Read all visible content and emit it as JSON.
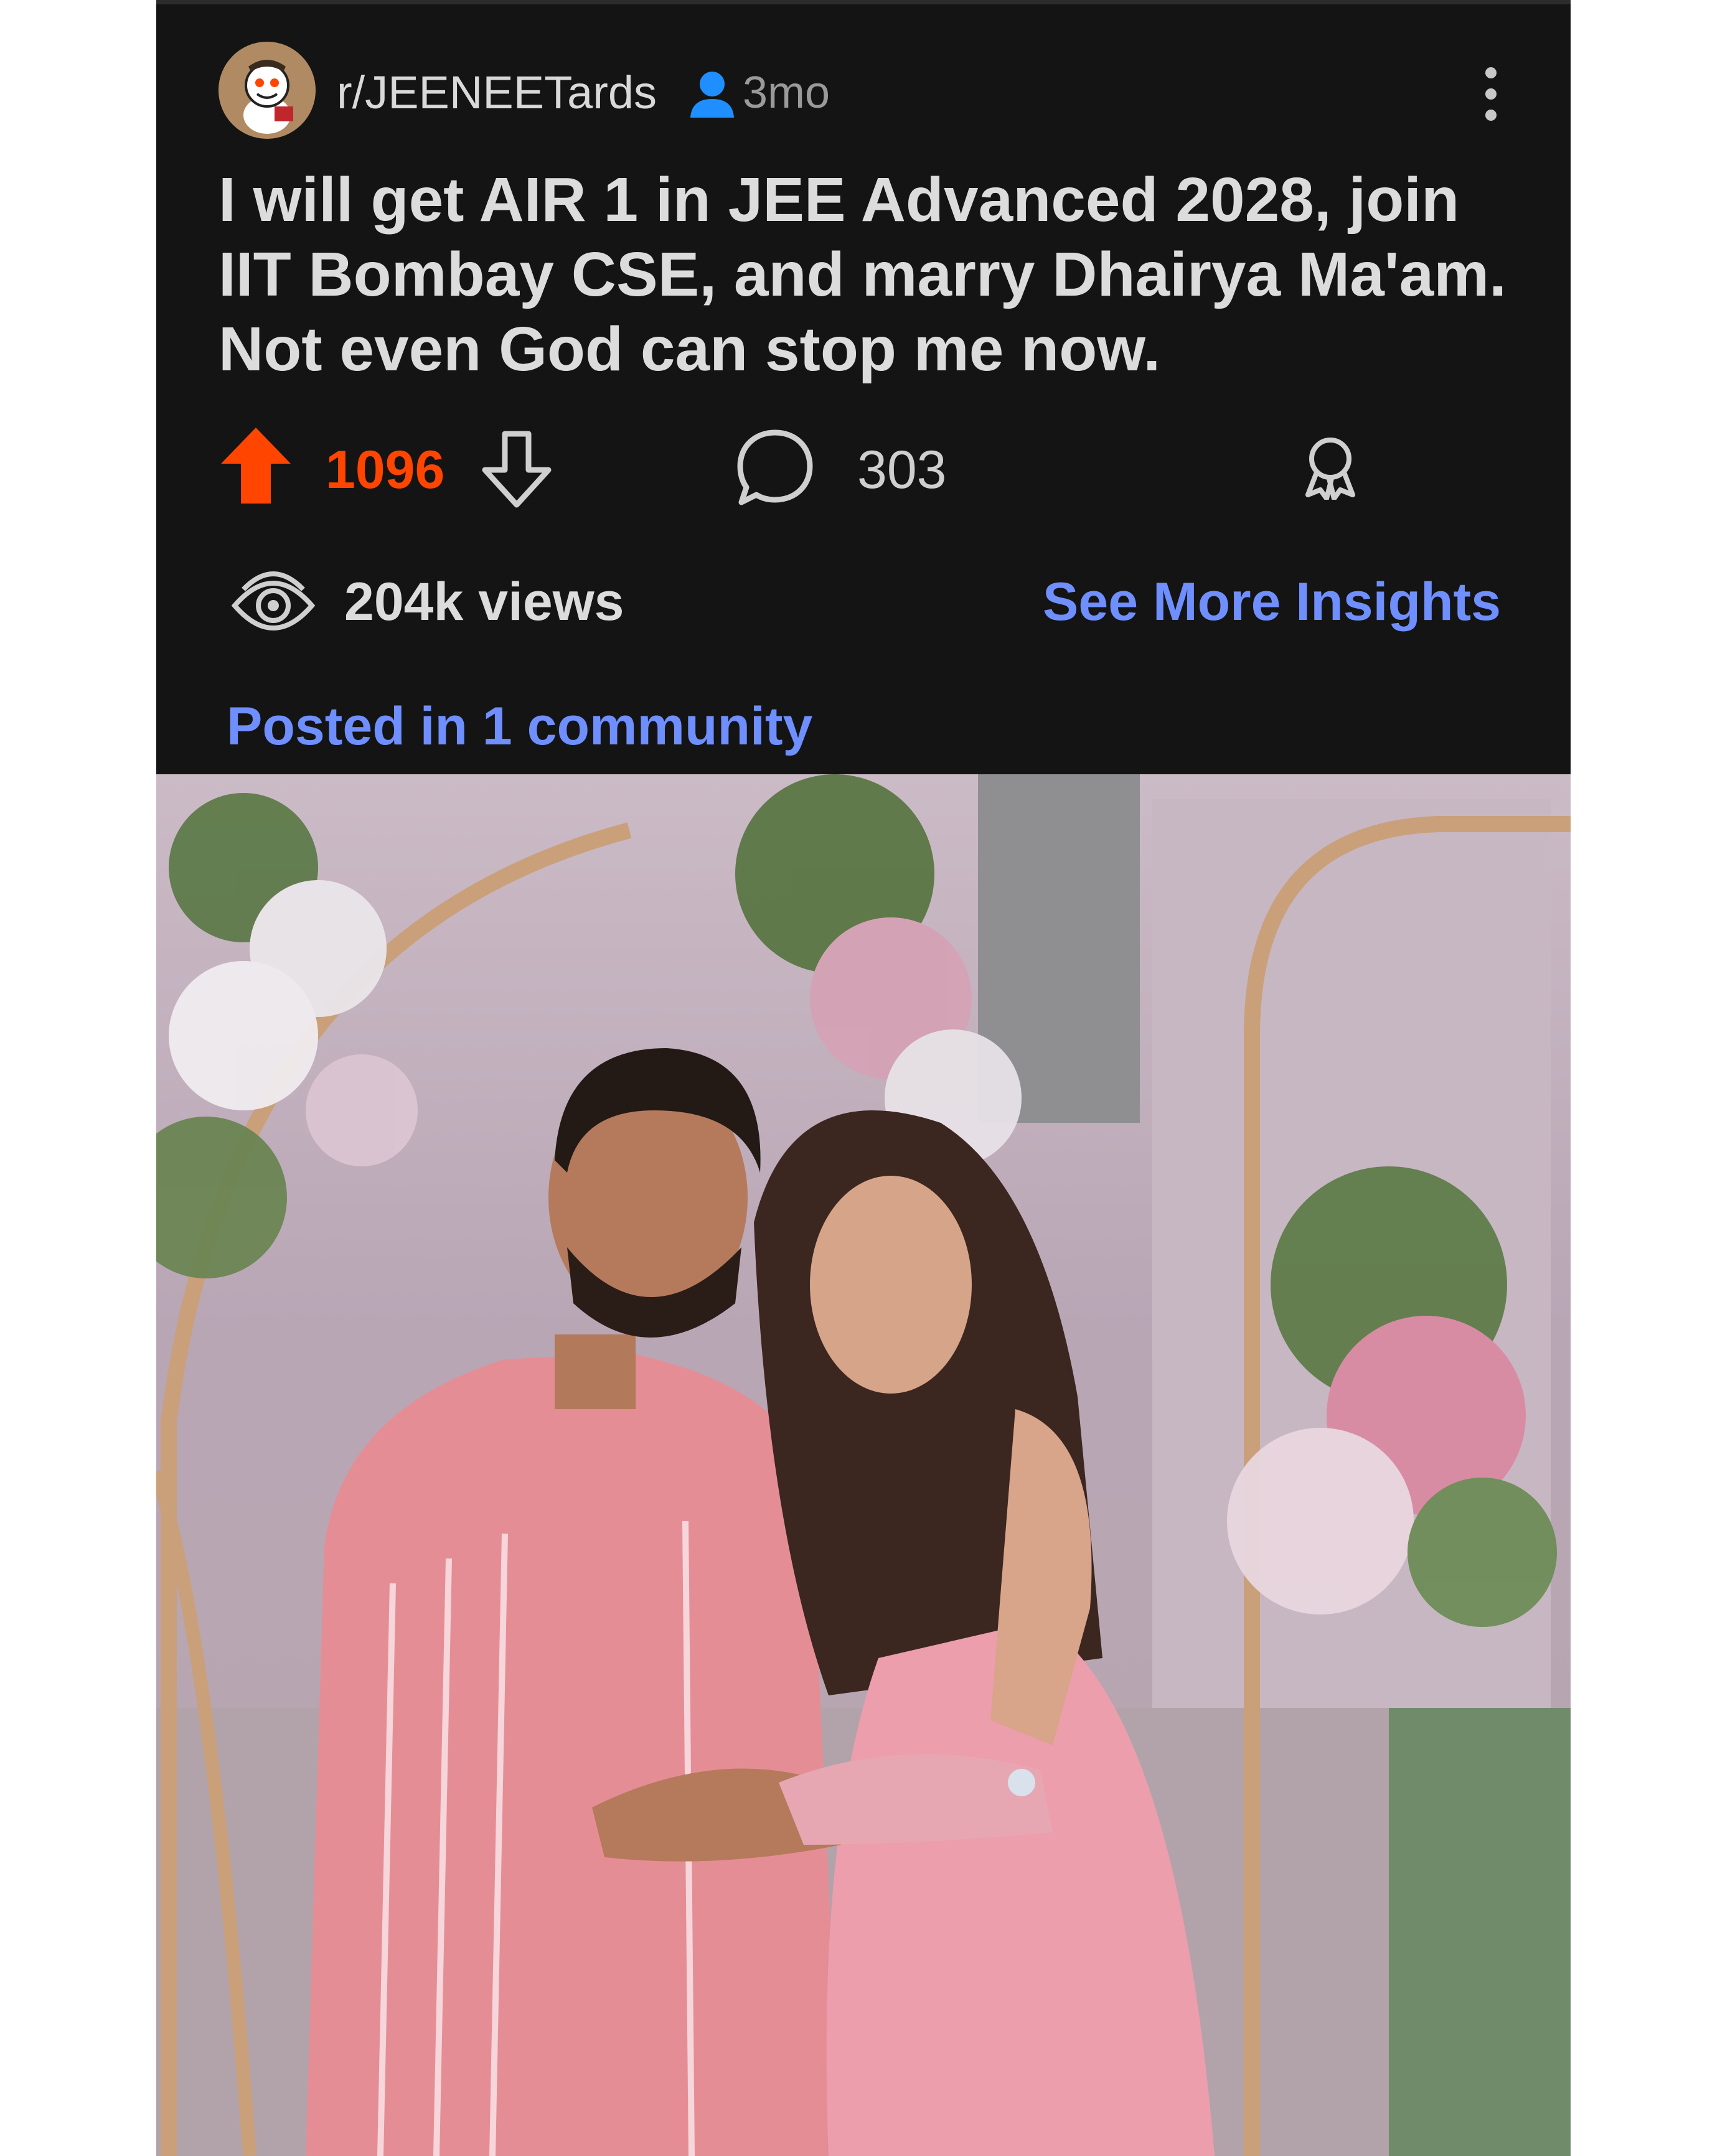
{
  "post": {
    "community": "r/JEENEETards",
    "age": "3mo",
    "title": "I will get AIR 1 in JEE Advanced 2028, join IIT Bombay CSE, and marry Dhairya Ma'am. Not even God can stop me now.",
    "score": "1096",
    "comments": "303",
    "views": "204k views",
    "insights_link": "See More Insights",
    "posted_in": "Posted in 1 community"
  },
  "colors": {
    "background": "#141414",
    "upvote_active": "#ff4500",
    "link_blue": "#6f8fff",
    "text_primary": "#dcdcdc",
    "text_secondary": "#9a9a9a"
  },
  "icons": {
    "avatar": "snoo-avatar-icon",
    "author": "person-icon",
    "menu": "more-vertical-icon",
    "upvote": "arrow-up-icon",
    "downvote": "arrow-down-icon",
    "comments": "speech-bubble-icon",
    "award": "award-ribbon-icon",
    "views": "eye-icon"
  }
}
